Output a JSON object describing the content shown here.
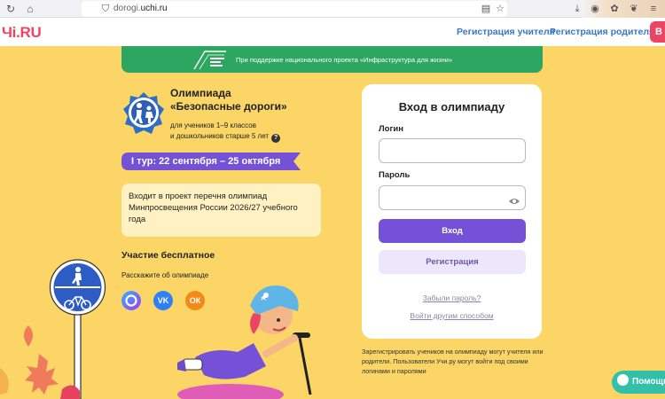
{
  "browser": {
    "url_prefix": "dorogi.",
    "url_domain": "uchi.ru"
  },
  "header": {
    "logo": "Чi.RU",
    "register_teacher": "Регистрация учителя",
    "register_parent": "Регистрация родителя",
    "cta_letter": "В"
  },
  "banner": {
    "text": "При поддержке национального проекта «Инфраструктура для жизни»"
  },
  "olympiad": {
    "title_line1": "Олимпиада",
    "title_line2": "«Безопасные дороги»",
    "sub_line1": "для учеников 1–9 классов",
    "sub_line2": "и дошкольников старше 5 лет",
    "help_glyph": "?",
    "tour": "I тур: 22 сентября – 25 октября",
    "info": "Входит в проект перечня олимпиад Минпросвещения России 2026/27 учебного года",
    "free_title": "Участие бесплатное",
    "share_label": "Расскажите об олимпиаде",
    "social": [
      "max",
      "vk",
      "ok"
    ]
  },
  "login": {
    "title": "Вход в олимпиаду",
    "login_label": "Логин",
    "login_value": "",
    "password_label": "Пароль",
    "password_value": "",
    "enter_btn": "Вход",
    "register_btn": "Регистрация",
    "forgot_link": "Забыли пароль?",
    "other_link": "Войти другим способом"
  },
  "note": "Зарегистрировать учеников на олимпиаду могут учителя или родители. Пользователи Учи.ру могут войти под своими логинами и паролями",
  "help": {
    "label": "Помощь"
  },
  "colors": {
    "background": "#fbd667",
    "brand_red": "#ec4562",
    "link_blue": "#3877c9",
    "banner_green": "#2ca660",
    "primary_purple": "#7451d6",
    "help_teal": "#33c0a8"
  }
}
